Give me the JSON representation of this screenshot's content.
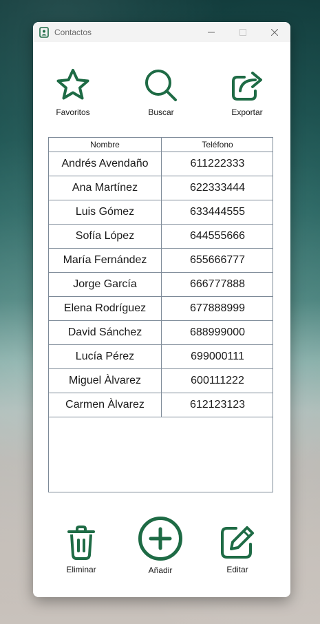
{
  "window": {
    "title": "Contactos",
    "icon": "contact-book-icon"
  },
  "toolbar": {
    "favorites_label": "Favoritos",
    "search_label": "Buscar",
    "export_label": "Exportar"
  },
  "table": {
    "columns": [
      "Nombre",
      "Teléfono"
    ],
    "rows": [
      {
        "name": "Andrés Avendaño",
        "phone": "611222333"
      },
      {
        "name": "Ana Martínez",
        "phone": "622333444"
      },
      {
        "name": "Luis Gómez",
        "phone": "633444555"
      },
      {
        "name": "Sofía López",
        "phone": "644555666"
      },
      {
        "name": "María Fernández",
        "phone": "655666777"
      },
      {
        "name": "Jorge García",
        "phone": "666777888"
      },
      {
        "name": "Elena Rodríguez",
        "phone": "677888999"
      },
      {
        "name": "David Sánchez",
        "phone": "688999000"
      },
      {
        "name": "Lucía Pérez",
        "phone": "699000111"
      },
      {
        "name": "Miguel Àlvarez",
        "phone": "600111222"
      },
      {
        "name": "Carmen Àlvarez",
        "phone": "612123123"
      }
    ]
  },
  "actions": {
    "delete_label": "Eliminar",
    "add_label": "Añadir",
    "edit_label": "Editar"
  },
  "colors": {
    "accent": "#1e6b45"
  }
}
